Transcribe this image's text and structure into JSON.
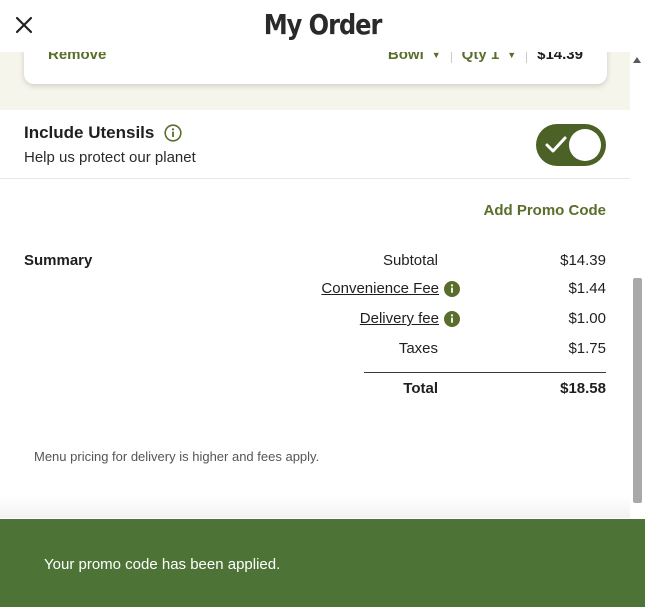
{
  "header": {
    "title": "My Order",
    "close_icon": "close-icon"
  },
  "cart_item": {
    "remove_label": "Remove",
    "size_label": "Bowl",
    "qty_label": "Qty 1",
    "price": "$14.39",
    "caret_icon": "caret-down-icon"
  },
  "utensils": {
    "title": "Include Utensils",
    "subtitle": "Help us protect our planet",
    "toggle_on": true,
    "info_icon": "info-outline-icon"
  },
  "promo": {
    "link_label": "Add Promo Code"
  },
  "summary": {
    "label": "Summary",
    "rows": [
      {
        "label": "Subtotal",
        "value": "$14.39"
      },
      {
        "label": "Convenience Fee",
        "value": "$1.44",
        "info_icon": "info-filled-icon"
      },
      {
        "label": "Delivery fee",
        "value": "$1.00",
        "info_icon": "info-filled-icon"
      },
      {
        "label": "Taxes",
        "value": "$1.75"
      }
    ],
    "total_label": "Total",
    "total_value": "$18.58"
  },
  "footnote": "Menu pricing for delivery is higher and fees apply.",
  "toast": {
    "message": "Your promo code has been applied."
  },
  "colors": {
    "brand_green": "#5a6e2b",
    "toggle_green": "#4c6126",
    "toast_green": "#4e7337",
    "band_bg": "#f6f5ec"
  }
}
